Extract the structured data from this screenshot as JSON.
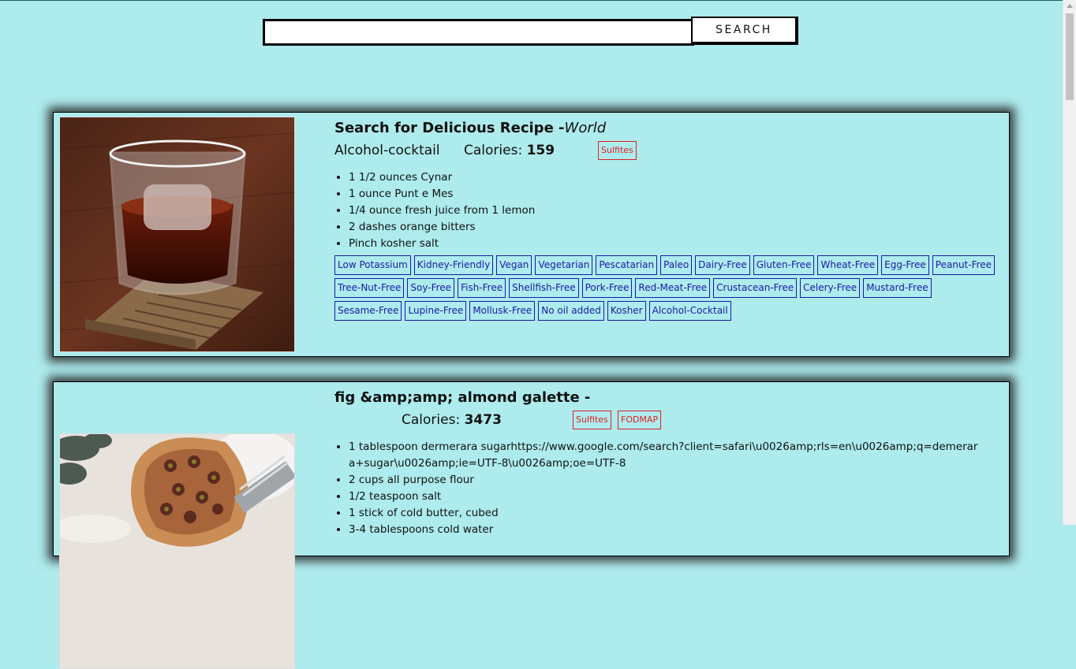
{
  "search": {
    "placeholder": "",
    "value": "",
    "button_label": "SEARCH"
  },
  "recipes": [
    {
      "title": "Search for Delicious Recipe -",
      "source": "World",
      "dish_type": "Alcohol-cocktail",
      "calories_label": "Calories:",
      "calories": "159",
      "cautions": [
        "Sulfites"
      ],
      "ingredients": [
        "1 1/2 ounces Cynar",
        "1 ounce Punt e Mes",
        "1/4 ounce fresh juice from 1 lemon",
        "2 dashes orange bitters",
        "Pinch kosher salt"
      ],
      "labels": [
        "Low Potassium",
        "Kidney-Friendly",
        "Vegan",
        "Vegetarian",
        "Pescatarian",
        "Paleo",
        "Dairy-Free",
        "Gluten-Free",
        "Wheat-Free",
        "Egg-Free",
        "Peanut-Free",
        "Tree-Nut-Free",
        "Soy-Free",
        "Fish-Free",
        "Shellfish-Free",
        "Pork-Free",
        "Red-Meat-Free",
        "Crustacean-Free",
        "Celery-Free",
        "Mustard-Free",
        "Sesame-Free",
        "Lupine-Free",
        "Mollusk-Free",
        "No oil added",
        "Kosher",
        "Alcohol-Cocktail"
      ]
    },
    {
      "title": "fig &amp;amp; almond galette -",
      "source": "",
      "dish_type": "",
      "calories_label": "Calories:",
      "calories": "3473",
      "cautions": [
        "Sulfites",
        "FODMAP"
      ],
      "ingredients": [
        "1 tablespoon dermerara sugarhttps://www.google.com/search?client=safari\\u0026amp;rls=en\\u0026amp;q=demerara+sugar\\u0026amp;ie=UTF-8\\u0026amp;oe=UTF-8",
        "2 cups all purpose flour",
        "1/2 teaspoon salt",
        "1 stick of cold butter, cubed",
        "3-4 tablespoons cold water"
      ]
    }
  ],
  "colors": {
    "background": "#adebed",
    "label_border": "#1a1aa8",
    "caution_border": "#d22222"
  }
}
